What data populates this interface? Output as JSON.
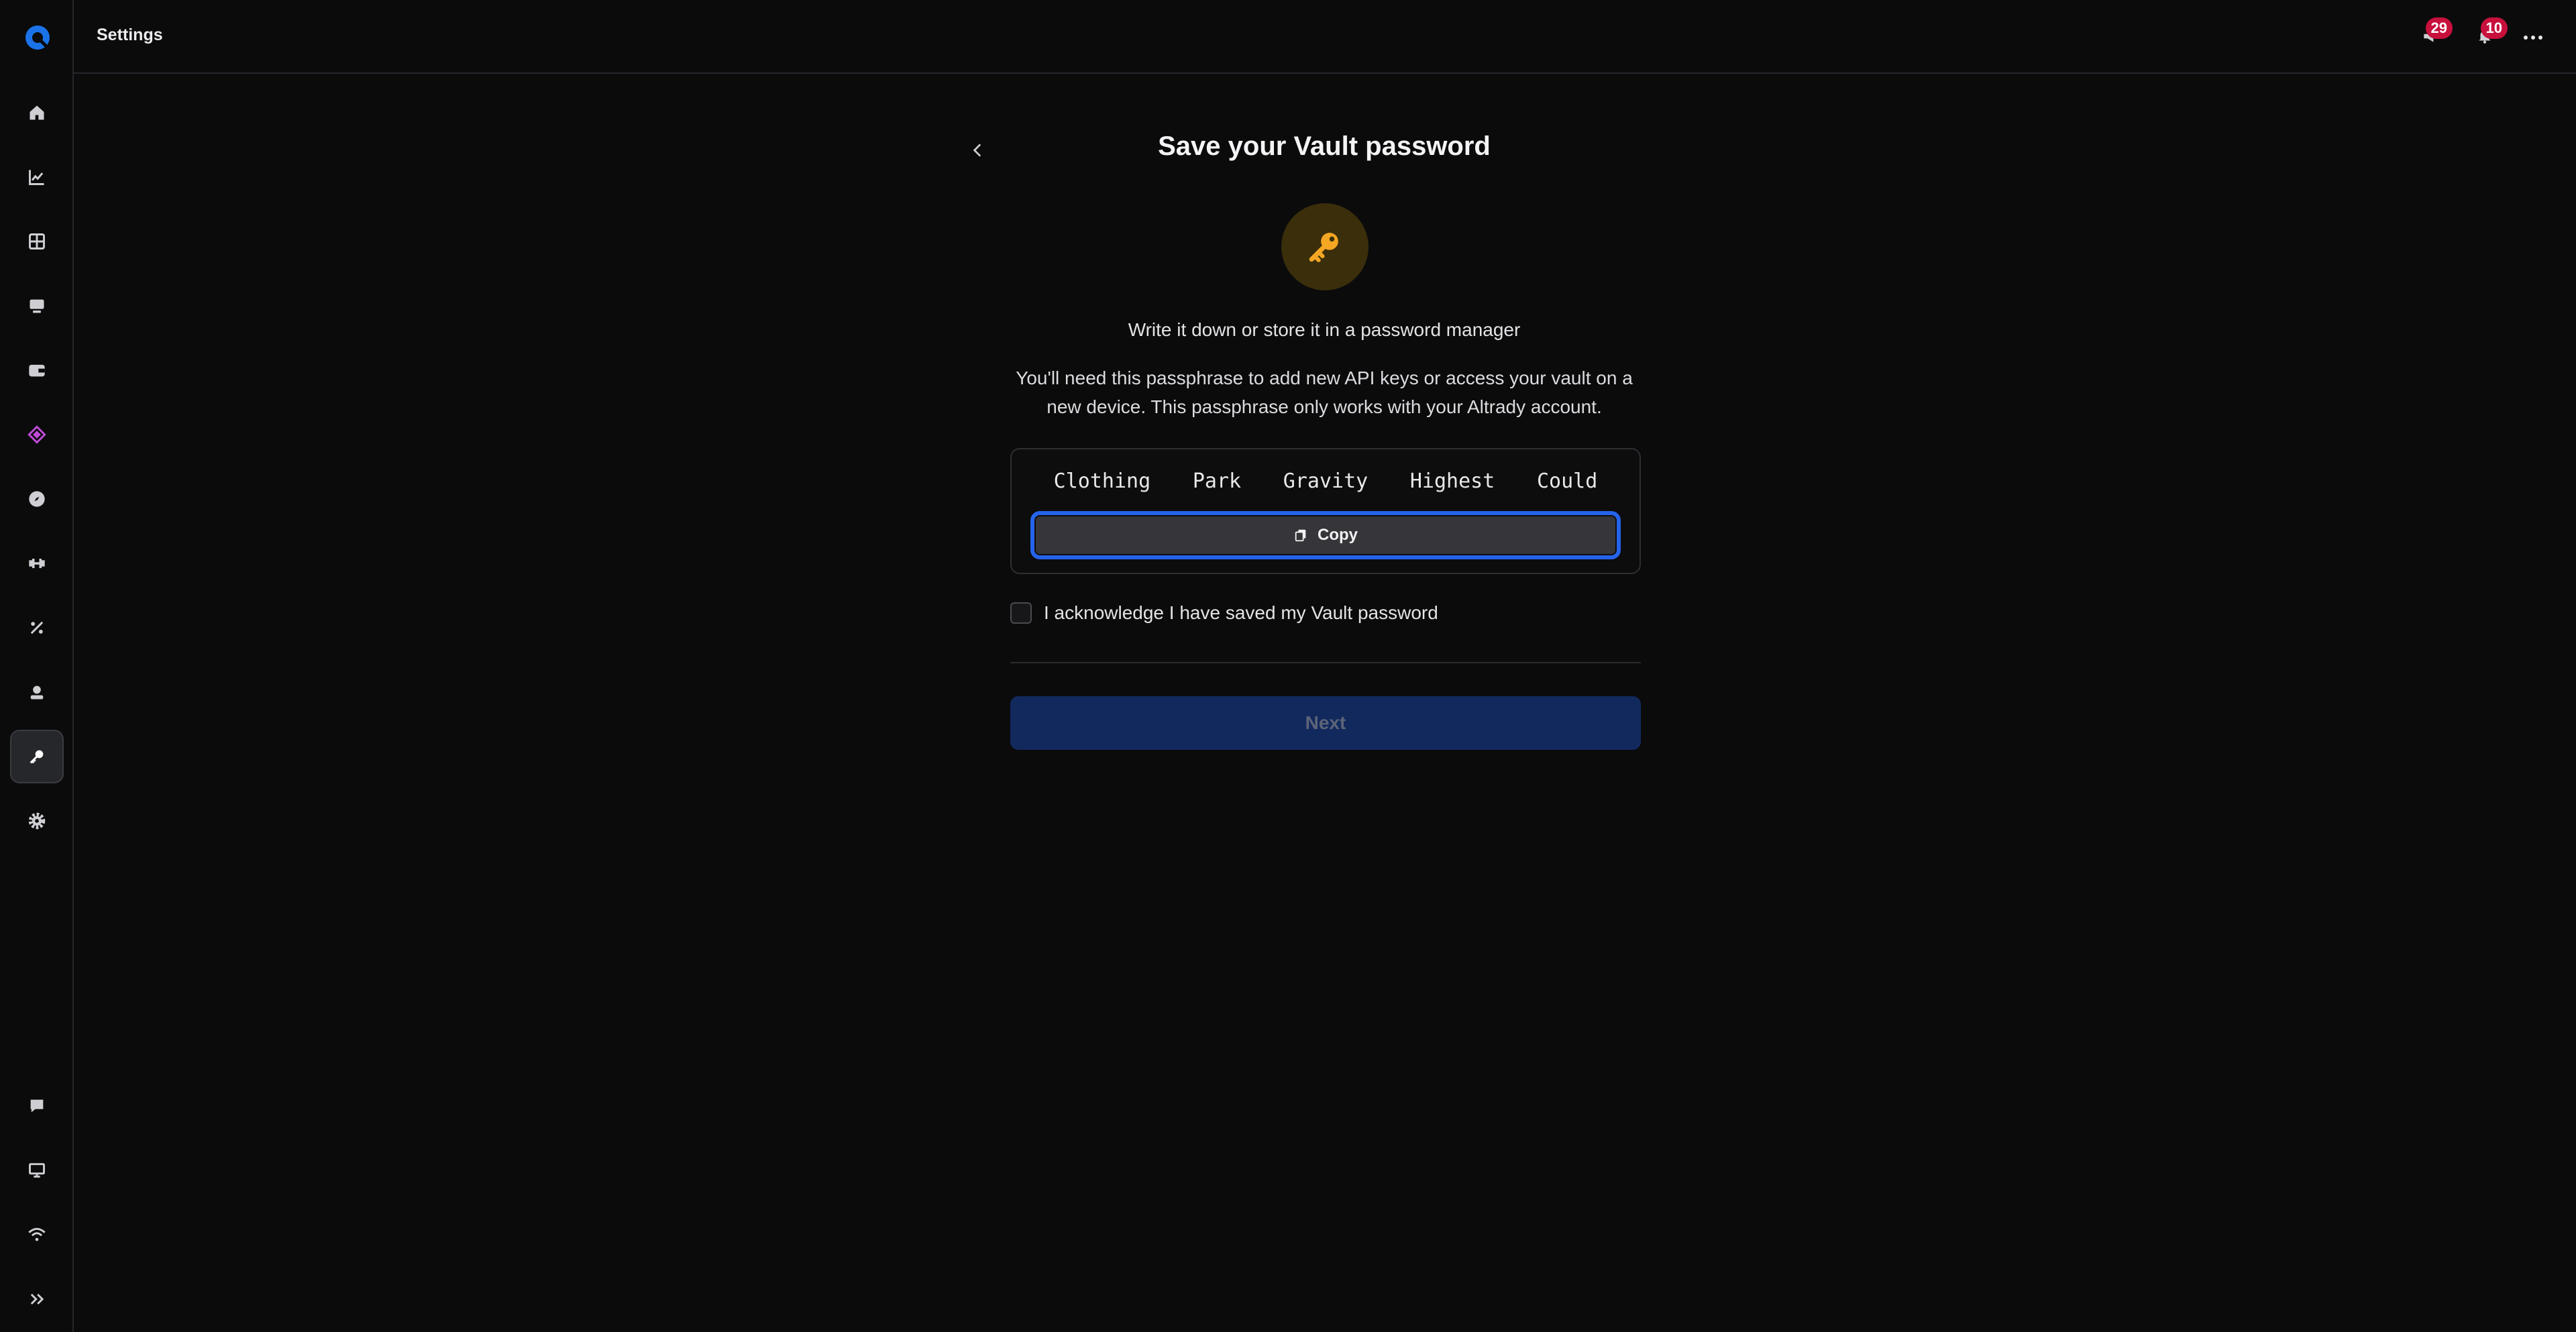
{
  "header": {
    "title": "Settings",
    "notifications": [
      {
        "icon": "announcement-icon",
        "count": "29"
      },
      {
        "icon": "bell-icon",
        "count": "10"
      }
    ]
  },
  "sidebar": {
    "items": [
      {
        "name": "home",
        "icon": "home-icon"
      },
      {
        "name": "analytics",
        "icon": "chart-icon"
      },
      {
        "name": "dashboard",
        "icon": "grid-icon"
      },
      {
        "name": "terminal",
        "icon": "monitor-icon"
      },
      {
        "name": "wallet",
        "icon": "wallet-icon"
      },
      {
        "name": "vault",
        "icon": "stack-icon",
        "accent": "#c04bd8"
      },
      {
        "name": "explore",
        "icon": "compass-icon"
      },
      {
        "name": "bots",
        "icon": "dumbbell-icon"
      },
      {
        "name": "fees",
        "icon": "percent-icon"
      },
      {
        "name": "account",
        "icon": "user-badge-icon"
      },
      {
        "name": "api-keys",
        "icon": "key-icon",
        "active": true
      },
      {
        "name": "settings",
        "icon": "gear-icon"
      }
    ],
    "bottom_items": [
      {
        "name": "support",
        "icon": "chat-icon"
      },
      {
        "name": "display",
        "icon": "desktop-icon"
      },
      {
        "name": "connection",
        "icon": "wifi-icon"
      },
      {
        "name": "expand",
        "icon": "chevrons-right-icon"
      }
    ]
  },
  "main": {
    "title": "Save your Vault password",
    "subtitle": "Write it down or store it in a password manager",
    "description": "You'll need this passphrase to add new API keys or access your vault on a new device. This passphrase only works with your Altrady account.",
    "passphrase_words": [
      "Clothing",
      "Park",
      "Gravity",
      "Highest",
      "Could"
    ],
    "copy_label": "Copy",
    "acknowledge_label": "I acknowledge I have saved my Vault password",
    "acknowledge_checked": false,
    "next_label": "Next"
  },
  "colors": {
    "accent_blue": "#2563eb",
    "key_gold": "#f5a623",
    "badge_red": "#c8103d"
  }
}
